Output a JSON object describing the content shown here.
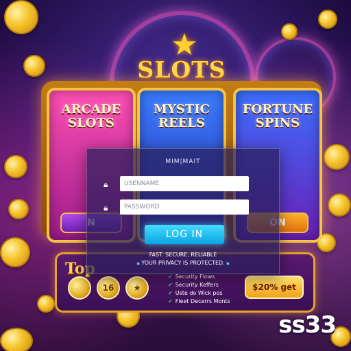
{
  "game": {
    "title": "SLOTS",
    "reels": [
      {
        "label_line1": "ARCADE",
        "label_line2": "SLOTS",
        "button": "N"
      },
      {
        "label_line1": "MYSTIC",
        "label_line2": "REELS",
        "button": ""
      },
      {
        "label_line1": "FORTUNE",
        "label_line2": "SPINS",
        "button": "ON"
      }
    ]
  },
  "login": {
    "title": "MIM|MAIT",
    "username_placeholder": "USENNAME",
    "password_placeholder": "PASSWORD",
    "submit_label": "LOG IN",
    "note_line1": "FAST. SECURE, RELIABLE",
    "note_line2": "YOUR PRIVACY IS PROTECTED."
  },
  "promo": {
    "title": "Top",
    "badge_mid": "16",
    "features": [
      "Security Flows",
      "Security Keffers",
      "Uste do Wick pos",
      "Fleet Decerrs Monts"
    ],
    "cta_label": "$20% get"
  },
  "brand": {
    "logo_text": "ss33"
  },
  "colors": {
    "accent": "#0aa5e3",
    "gold": "#f5c229",
    "panel": "#5a1a70"
  }
}
